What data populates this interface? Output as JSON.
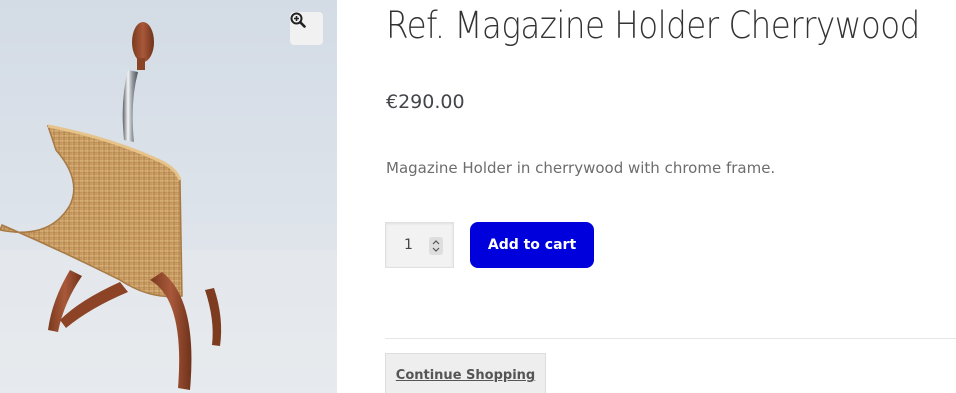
{
  "product": {
    "title": "Ref. Magazine Holder Cherrywood",
    "price": "€290.00",
    "description": "Magazine Holder in cherrywood with chrome frame.",
    "image_subject": "wicker magazine holder with cherrywood legs and chrome frame"
  },
  "gallery": {
    "zoom_icon": "zoom-in-icon"
  },
  "cart": {
    "quantity": "1",
    "add_to_cart_label": "Add to cart",
    "button_color": "#0000dd"
  },
  "navigation": {
    "continue_label": "Continue Shopping"
  }
}
